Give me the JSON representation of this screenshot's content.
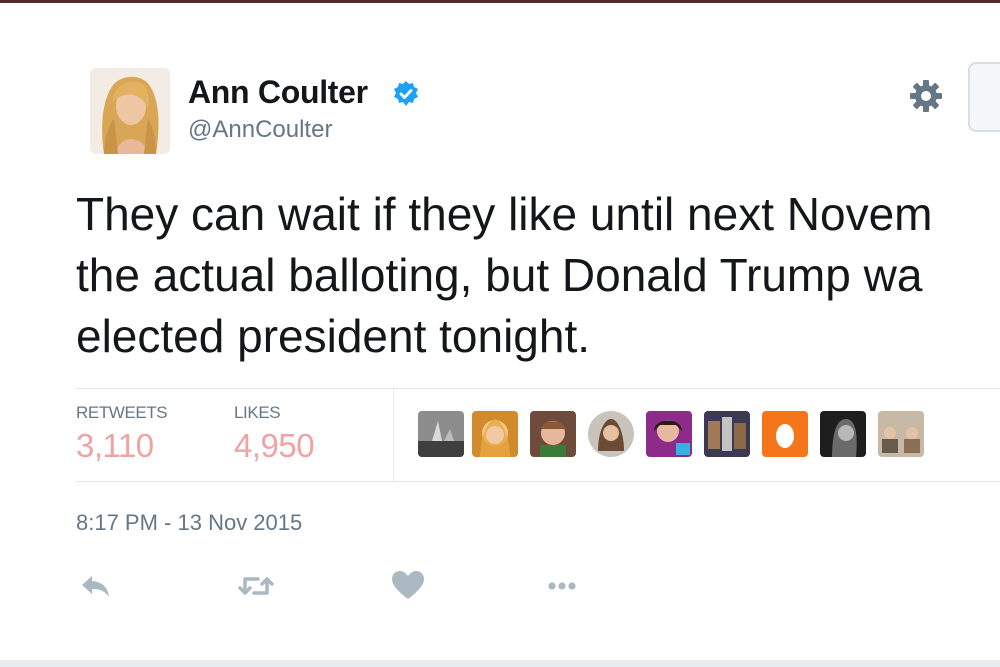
{
  "tweet": {
    "author_name": "Ann Coulter",
    "author_handle": "@AnnCoulter",
    "verified": true,
    "text_lines": [
      "They can wait if they like until next Novem",
      "the actual balloting, but Donald Trump wa",
      "elected president tonight."
    ],
    "timestamp": "8:17 PM - 13 Nov 2015"
  },
  "stats": {
    "retweets_label": "RETWEETS",
    "retweets_value": "3,110",
    "likes_label": "LIKES",
    "likes_value": "4,950"
  },
  "icons": {
    "verified": "verified-badge-icon",
    "settings": "gear-icon",
    "reply": "reply-icon",
    "retweet": "retweet-icon",
    "like": "heart-icon",
    "more": "more-icon"
  },
  "colors": {
    "verified_blue": "#1da1f2",
    "stat_value": "#f0a3a3",
    "muted_text": "#657786",
    "action_icon": "#aab8c2",
    "default_avatar_orange": "#f5761a"
  }
}
